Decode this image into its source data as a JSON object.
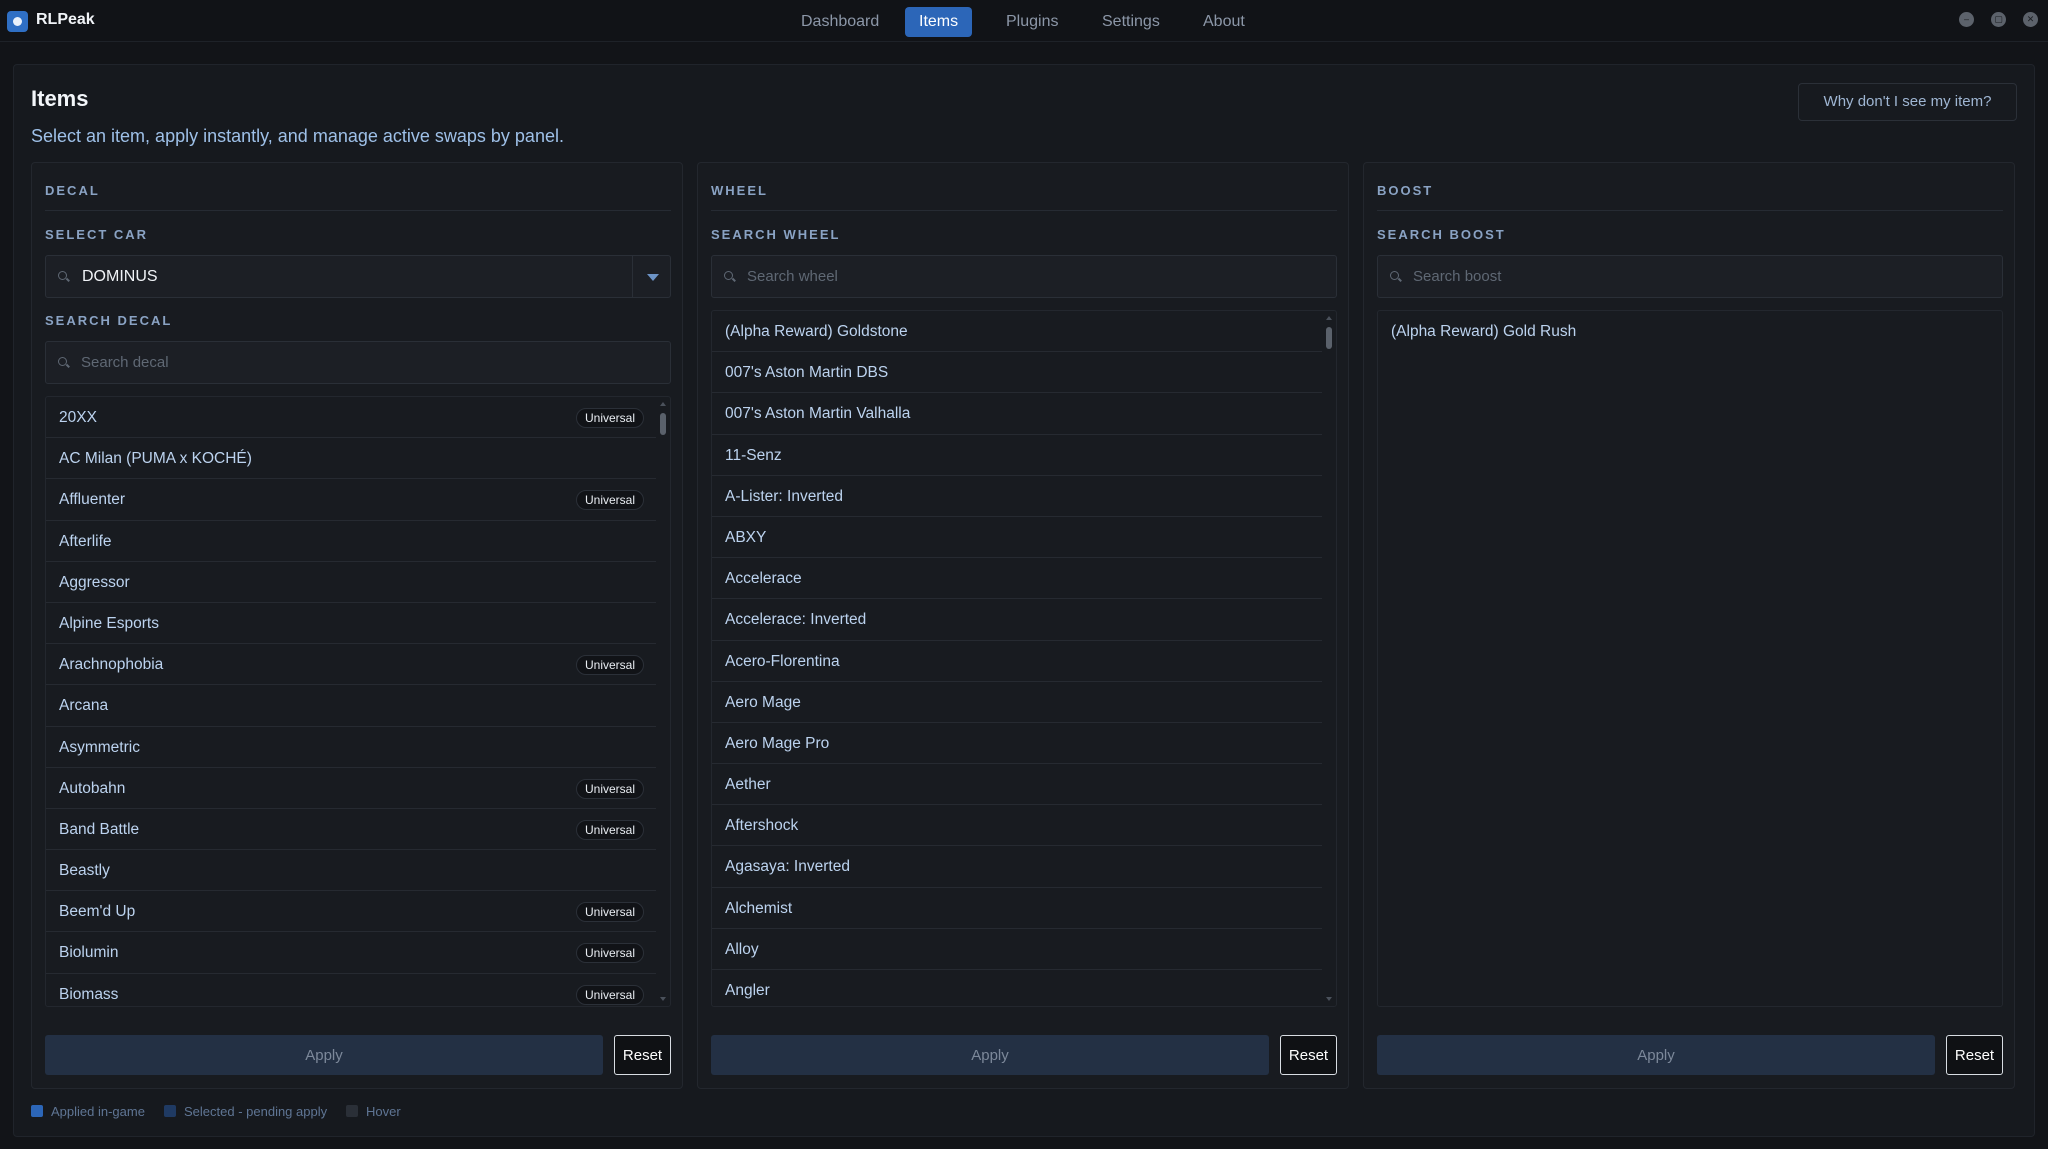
{
  "app": {
    "name": "RLPeak"
  },
  "nav": {
    "items": [
      {
        "label": "Dashboard",
        "active": false
      },
      {
        "label": "Items",
        "active": true
      },
      {
        "label": "Plugins",
        "active": false
      },
      {
        "label": "Settings",
        "active": false
      },
      {
        "label": "About",
        "active": false
      }
    ]
  },
  "window_controls": {
    "minimize": "–",
    "maximize": "▢",
    "close": "✕"
  },
  "page": {
    "title": "Items",
    "subtitle": "Select an item, apply instantly, and manage active swaps by panel.",
    "help_button": "Why don't I see my item?"
  },
  "panels": {
    "decal": {
      "title": "DECAL",
      "car_label": "SELECT CAR",
      "car_value": "DOMINUS",
      "search_label": "SEARCH DECAL",
      "search_placeholder": "Search decal",
      "apply_label": "Apply",
      "reset_label": "Reset",
      "items": [
        {
          "label": "20XX",
          "badge": "Universal"
        },
        {
          "label": "AC Milan (PUMA x KOCHÉ)",
          "badge": ""
        },
        {
          "label": "Affluenter",
          "badge": "Universal"
        },
        {
          "label": "Afterlife",
          "badge": ""
        },
        {
          "label": "Aggressor",
          "badge": ""
        },
        {
          "label": "Alpine Esports",
          "badge": ""
        },
        {
          "label": "Arachnophobia",
          "badge": "Universal"
        },
        {
          "label": "Arcana",
          "badge": ""
        },
        {
          "label": "Asymmetric",
          "badge": ""
        },
        {
          "label": "Autobahn",
          "badge": "Universal"
        },
        {
          "label": "Band Battle",
          "badge": "Universal"
        },
        {
          "label": "Beastly",
          "badge": ""
        },
        {
          "label": "Beem'd Up",
          "badge": "Universal"
        },
        {
          "label": "Biolumin",
          "badge": "Universal"
        },
        {
          "label": "Biomass",
          "badge": "Universal"
        }
      ]
    },
    "wheel": {
      "title": "WHEEL",
      "search_label": "SEARCH WHEEL",
      "search_placeholder": "Search wheel",
      "apply_label": "Apply",
      "reset_label": "Reset",
      "items": [
        {
          "label": "(Alpha Reward) Goldstone"
        },
        {
          "label": "007's Aston Martin DBS"
        },
        {
          "label": "007's Aston Martin Valhalla"
        },
        {
          "label": "11-Senz"
        },
        {
          "label": "A-Lister: Inverted"
        },
        {
          "label": "ABXY"
        },
        {
          "label": "Accelerace"
        },
        {
          "label": "Accelerace: Inverted"
        },
        {
          "label": "Acero-Florentina"
        },
        {
          "label": "Aero Mage"
        },
        {
          "label": "Aero Mage Pro"
        },
        {
          "label": "Aether"
        },
        {
          "label": "Aftershock"
        },
        {
          "label": "Agasaya: Inverted"
        },
        {
          "label": "Alchemist"
        },
        {
          "label": "Alloy"
        },
        {
          "label": "Angler"
        }
      ]
    },
    "boost": {
      "title": "BOOST",
      "search_label": "SEARCH BOOST",
      "search_placeholder": "Search boost",
      "apply_label": "Apply",
      "reset_label": "Reset",
      "items": [
        {
          "label": "(Alpha Reward) Gold Rush"
        }
      ]
    }
  },
  "legend": [
    {
      "label": "Applied in-game",
      "color": "#2c66b8"
    },
    {
      "label": "Selected - pending apply",
      "color": "#1f3a63"
    },
    {
      "label": "Hover",
      "color": "#2a2f37"
    }
  ],
  "colors": {
    "accent": "#2c66b8",
    "background": "#121418",
    "panel": "#181b20",
    "item_text": "#bcd3ef",
    "section_label": "#8aa3c4"
  },
  "icons": {
    "app_logo": "rlpeak-logo-icon",
    "search": "search-icon",
    "dropdown": "chevron-down-icon"
  }
}
